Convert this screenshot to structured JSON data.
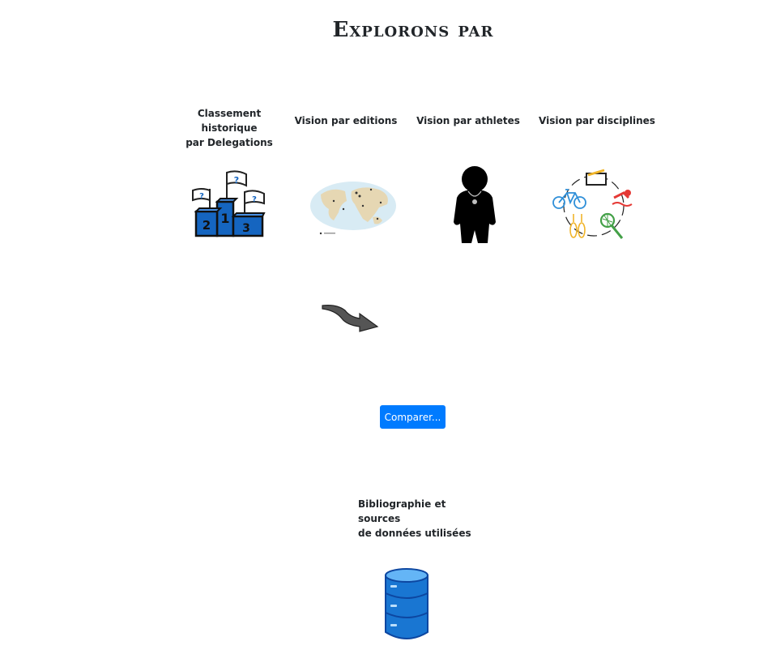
{
  "page": {
    "title": "Explorons par"
  },
  "cards": [
    {
      "line1": "Classement historique",
      "line2": "par Delegations",
      "icon": "podium-icon"
    },
    {
      "line1": "Vision par editions",
      "line2": "",
      "icon": "world-map-icon"
    },
    {
      "line1": "Vision par athletes",
      "line2": "",
      "icon": "athlete-silhouette-icon"
    },
    {
      "line1": "Vision par disciplines",
      "line2": "",
      "icon": "disciplines-cycle-icon"
    }
  ],
  "podium": {
    "places": [
      "1",
      "2",
      "3"
    ],
    "flags": [
      "?",
      "?",
      "?"
    ]
  },
  "compare": {
    "label": "Comparer..."
  },
  "biblio": {
    "line1": "Bibliographie et sources",
    "line2": "de données utilisées",
    "icon": "database-icon"
  },
  "colors": {
    "accent": "#007bff",
    "podium": "#1565c0",
    "text": "#212529"
  }
}
